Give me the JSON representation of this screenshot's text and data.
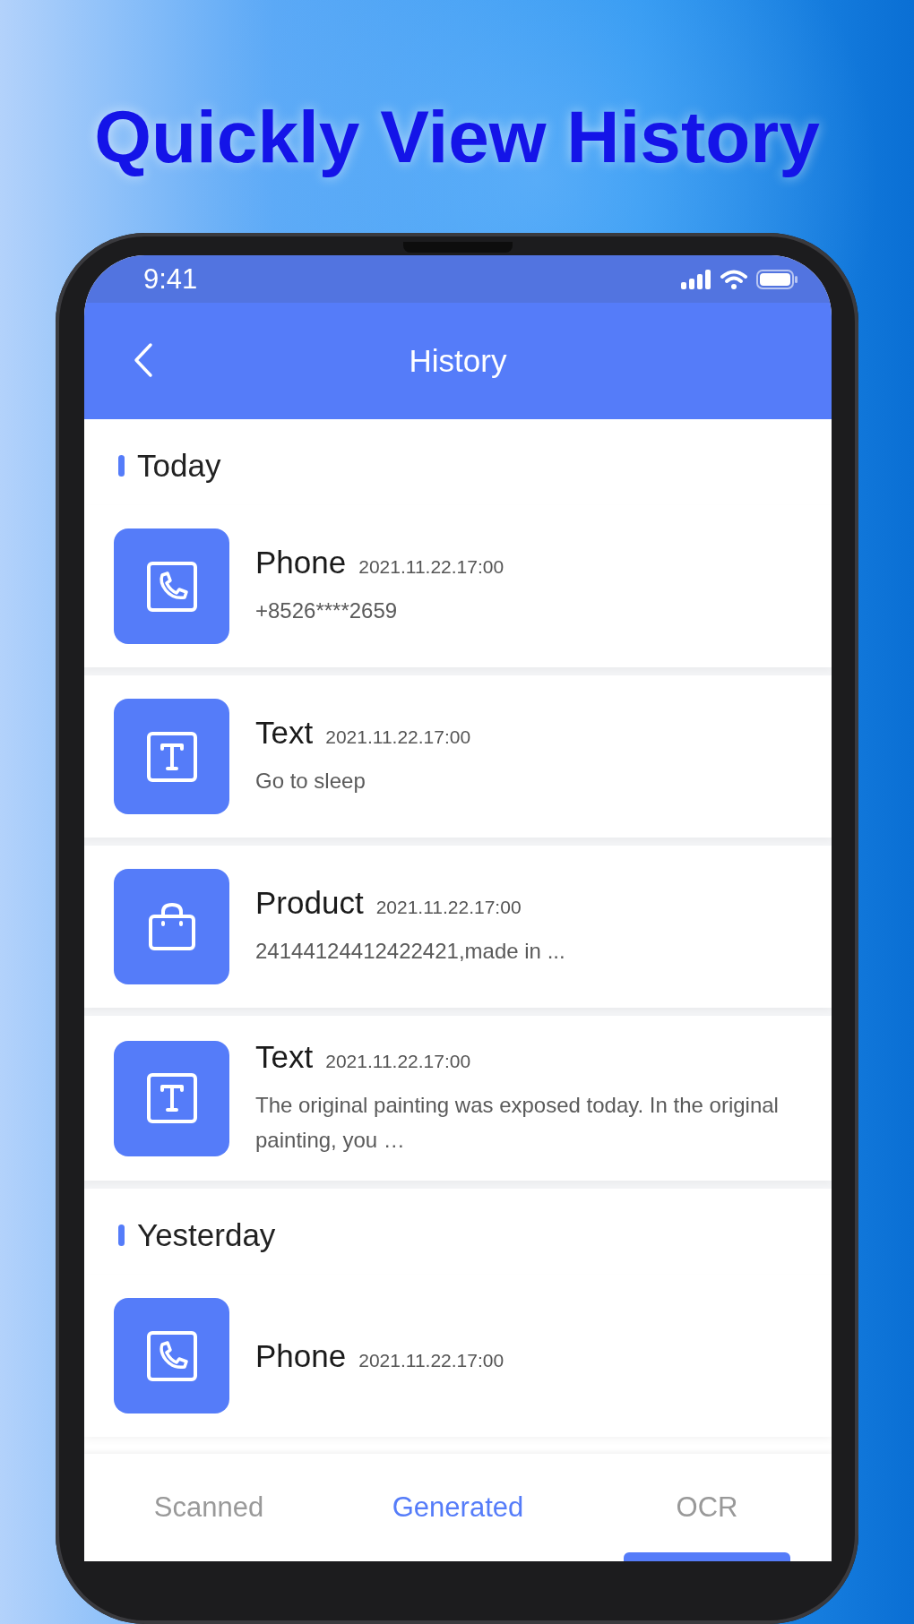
{
  "hero_title": "Quickly View History",
  "status_bar": {
    "time": "9:41"
  },
  "header": {
    "title": "History"
  },
  "sections": [
    {
      "label": "Today",
      "items": [
        {
          "kind": "phone",
          "title": "Phone",
          "time": "2021.11.22.17:00",
          "detail": "+8526****2659"
        },
        {
          "kind": "text",
          "title": "Text",
          "time": "2021.11.22.17:00",
          "detail": "Go to sleep"
        },
        {
          "kind": "product",
          "title": "Product",
          "time": "2021.11.22.17:00",
          "detail": "24144124412422421,made in ..."
        },
        {
          "kind": "text",
          "title": "Text",
          "time": "2021.11.22.17:00",
          "detail": "The original painting was exposed today. In the original painting, you …"
        }
      ]
    },
    {
      "label": "Yesterday",
      "items": [
        {
          "kind": "phone",
          "title": "Phone",
          "time": "2021.11.22.17:00"
        }
      ]
    }
  ],
  "tabs": [
    {
      "label": "Scanned",
      "selected": false
    },
    {
      "label": "Generated",
      "selected": true
    },
    {
      "label": "OCR",
      "selected": false
    }
  ]
}
